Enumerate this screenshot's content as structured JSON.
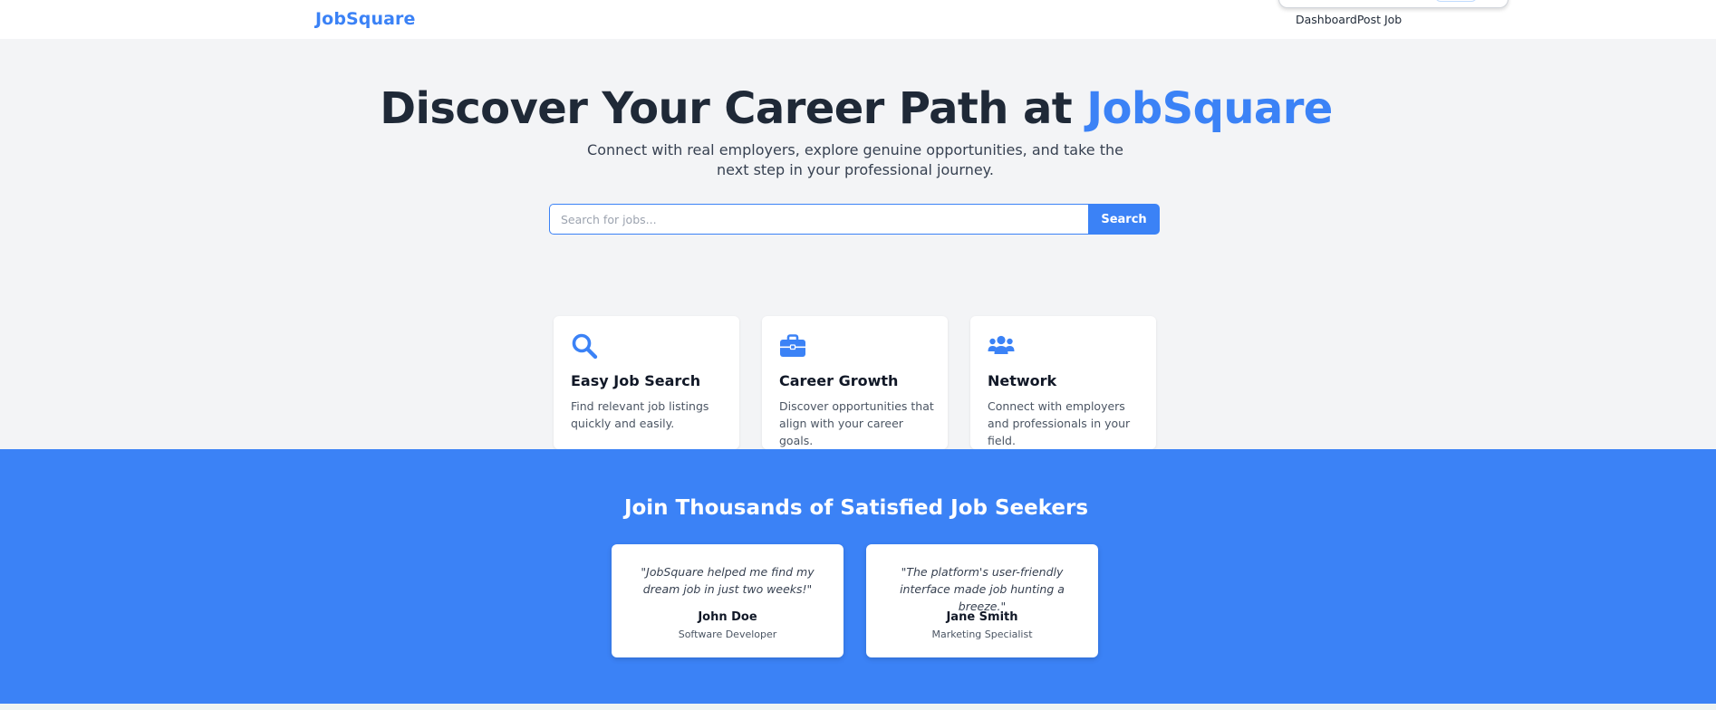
{
  "header": {
    "logo": "JobSquare",
    "nav": [
      {
        "label": "Dashboard"
      },
      {
        "label": "Post Job"
      }
    ]
  },
  "hero": {
    "title_prefix": "Discover Your Career Path at ",
    "title_accent": "JobSquare",
    "subtitle": "Connect with real employers, explore genuine opportunities, and take the next step in your professional journey.",
    "search": {
      "placeholder": "Search for jobs...",
      "value": "",
      "button_label": "Search"
    }
  },
  "features": [
    {
      "icon": "search-icon",
      "title": "Easy Job Search",
      "description": "Find relevant job listings quickly and easily."
    },
    {
      "icon": "briefcase-icon",
      "title": "Career Growth",
      "description": "Discover opportunities that align with your career goals."
    },
    {
      "icon": "users-icon",
      "title": "Network",
      "description": "Connect with employers and professionals in your field."
    }
  ],
  "testimonials": {
    "heading": "Join Thousands of Satisfied Job Seekers",
    "items": [
      {
        "quote": "\"JobSquare helped me find my dream job in just two weeks!\"",
        "name": "John Doe",
        "role": "Software Developer"
      },
      {
        "quote": "\"The platform's user-friendly interface made job hunting a breeze.\"",
        "name": "Jane Smith",
        "role": "Marketing Specialist"
      }
    ]
  },
  "colors": {
    "accent": "#3b82f6",
    "background": "#f3f4f6",
    "text": "#1f2937"
  }
}
